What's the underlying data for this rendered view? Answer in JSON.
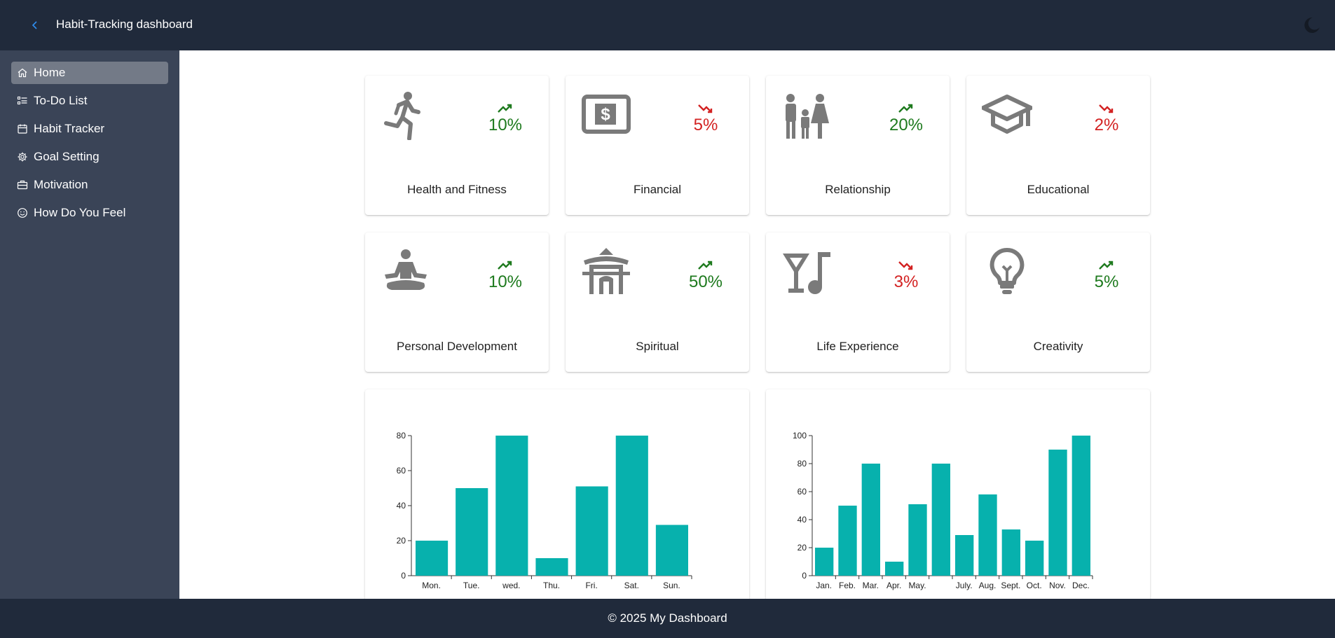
{
  "header": {
    "title": "Habit-Tracking dashboard",
    "back_icon": "chevron-left-icon",
    "theme_icon": "moon-icon"
  },
  "sidebar": {
    "items": [
      {
        "label": "Home",
        "icon": "home-icon",
        "active": true
      },
      {
        "label": "To-Do List",
        "icon": "list-icon",
        "active": false
      },
      {
        "label": "Habit Tracker",
        "icon": "calendar-icon",
        "active": false
      },
      {
        "label": "Goal Setting",
        "icon": "gear-icon",
        "active": false
      },
      {
        "label": "Motivation",
        "icon": "briefcase-icon",
        "active": false
      },
      {
        "label": "How Do You Feel",
        "icon": "smile-icon",
        "active": false
      }
    ]
  },
  "categories": [
    {
      "label": "Health and Fitness",
      "percent": "10%",
      "trend": "up",
      "icon": "running-person-icon"
    },
    {
      "label": "Financial",
      "percent": "5%",
      "trend": "down",
      "icon": "dollar-bill-icon"
    },
    {
      "label": "Relationship",
      "percent": "20%",
      "trend": "up",
      "icon": "family-icon"
    },
    {
      "label": "Educational",
      "percent": "2%",
      "trend": "down",
      "icon": "graduation-cap-icon"
    },
    {
      "label": "Personal Development",
      "percent": "10%",
      "trend": "up",
      "icon": "meditation-icon"
    },
    {
      "label": "Spiritual",
      "percent": "50%",
      "trend": "up",
      "icon": "temple-icon"
    },
    {
      "label": "Life Experience",
      "percent": "3%",
      "trend": "down",
      "icon": "nightlife-icon"
    },
    {
      "label": "Creativity",
      "percent": "5%",
      "trend": "up",
      "icon": "lightbulb-icon"
    }
  ],
  "colors": {
    "header_bg": "#202a3b",
    "sidebar_bg": "#3a4457",
    "active_item": "#737a87",
    "bar": "#07b1ad",
    "trend_up": "#1e7a1e",
    "trend_down": "#d32222",
    "icon_gray": "#7a7a7a"
  },
  "chart_data": [
    {
      "type": "bar",
      "categories": [
        "Mon.",
        "Tue.",
        "wed.",
        "Thu.",
        "Fri.",
        "Sat.",
        "Sun."
      ],
      "values": [
        20,
        50,
        80,
        10,
        51,
        80,
        29
      ],
      "yticks": [
        0,
        20,
        40,
        60,
        80
      ],
      "ylim": [
        0,
        80
      ]
    },
    {
      "type": "bar",
      "categories": [
        "Jan.",
        "Feb.",
        "Mar.",
        "Apr.",
        "May.",
        "",
        "July.",
        "Aug.",
        "Sept.",
        "Oct.",
        "Nov.",
        "Dec."
      ],
      "values": [
        20,
        50,
        80,
        10,
        51,
        80,
        29,
        58,
        33,
        25,
        90,
        100
      ],
      "yticks": [
        0,
        20,
        40,
        60,
        80,
        100
      ],
      "ylim": [
        0,
        100
      ]
    }
  ],
  "footer": {
    "text": "© 2025 My Dashboard"
  }
}
